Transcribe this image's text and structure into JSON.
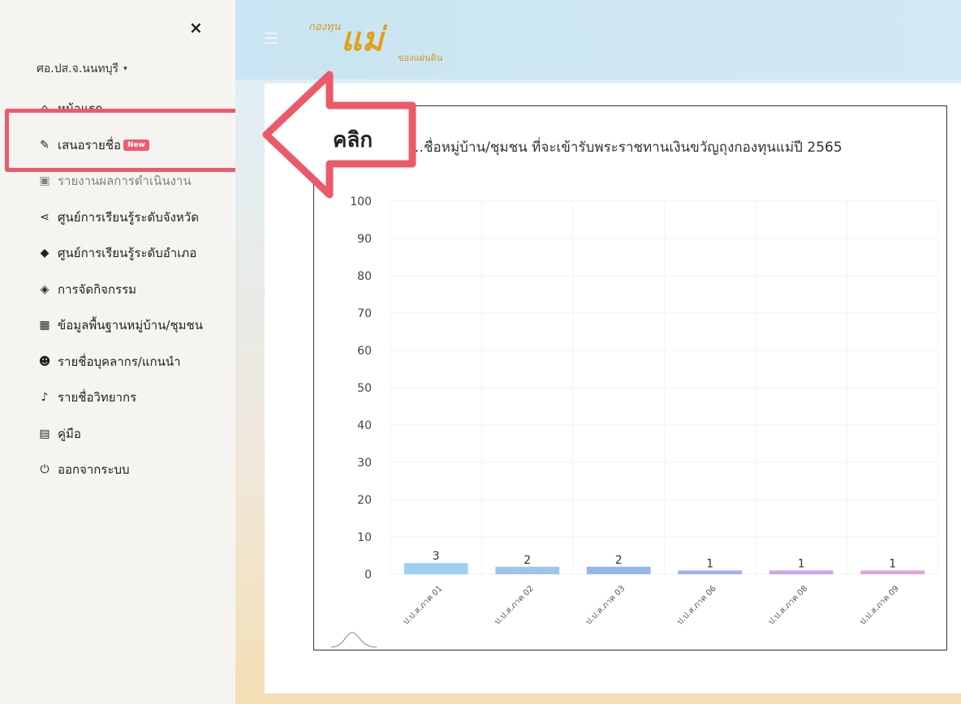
{
  "sidebar": {
    "close_label": "×",
    "org_label": "ศอ.ปส.จ.นนทบุรี",
    "caret": "▾",
    "items": [
      {
        "icon": "home-icon",
        "glyph": "⌂",
        "label": "หน้าแรก"
      },
      {
        "icon": "edit-icon",
        "glyph": "✎",
        "label": "เสนอรายชื่อ",
        "badge": "New"
      },
      {
        "icon": "report-icon",
        "glyph": "▣",
        "label": "รายงานผลการดำเนินงาน"
      },
      {
        "icon": "share-icon",
        "glyph": "⋖",
        "label": "ศูนย์การเรียนรู้ระดับจังหวัด"
      },
      {
        "icon": "shapes-icon",
        "glyph": "◆",
        "label": "ศูนย์การเรียนรู้ระดับอำเภอ"
      },
      {
        "icon": "activity-icon",
        "glyph": "◈",
        "label": "การจัดกิจกรรม"
      },
      {
        "icon": "building-icon",
        "glyph": "▦",
        "label": "ข้อมูลพื้นฐานหมู่บ้าน/ชุมชน"
      },
      {
        "icon": "user-plus-icon",
        "glyph": "☻",
        "label": "รายชื่อบุคลากร/แกนนำ"
      },
      {
        "icon": "microphone-icon",
        "glyph": "♪",
        "label": "รายชื่อวิทยากร"
      },
      {
        "icon": "book-icon",
        "glyph": "▤",
        "label": "คู่มือ"
      },
      {
        "icon": "power-icon",
        "glyph": "⏻",
        "label": "ออกจากระบบ"
      }
    ]
  },
  "header": {
    "logo_line1": "กองทุน",
    "logo_line2": "แม่",
    "logo_line3": "ของแผ่นดิน"
  },
  "annotation": {
    "label": "คลิก",
    "color": "#ec5a6a"
  },
  "chart_data": {
    "type": "bar",
    "title": "…ชื่อหมู่บ้าน/ชุมชน ที่จะเข้ารับพระราชทานเงินขวัญถุงกองทุนแม่ปี 2565",
    "categories": [
      "ป.ป.ส.ภาค 01",
      "ป.ป.ส.ภาค 02",
      "ป.ป.ส.ภาค 03",
      "ป.ป.ส.ภาค 06",
      "ป.ป.ส.ภาค 08",
      "ป.ป.ส.ภาค 09"
    ],
    "values": [
      3,
      2,
      2,
      1,
      1,
      1
    ],
    "colors": [
      "#9fd0f0",
      "#9cc5ea",
      "#93b7e8",
      "#a3aee6",
      "#c3a8ea",
      "#e0a3e2"
    ],
    "ylim": [
      0,
      100
    ],
    "yticks": [
      0,
      10,
      20,
      30,
      40,
      50,
      60,
      70,
      80,
      90,
      100
    ],
    "grid": true
  }
}
